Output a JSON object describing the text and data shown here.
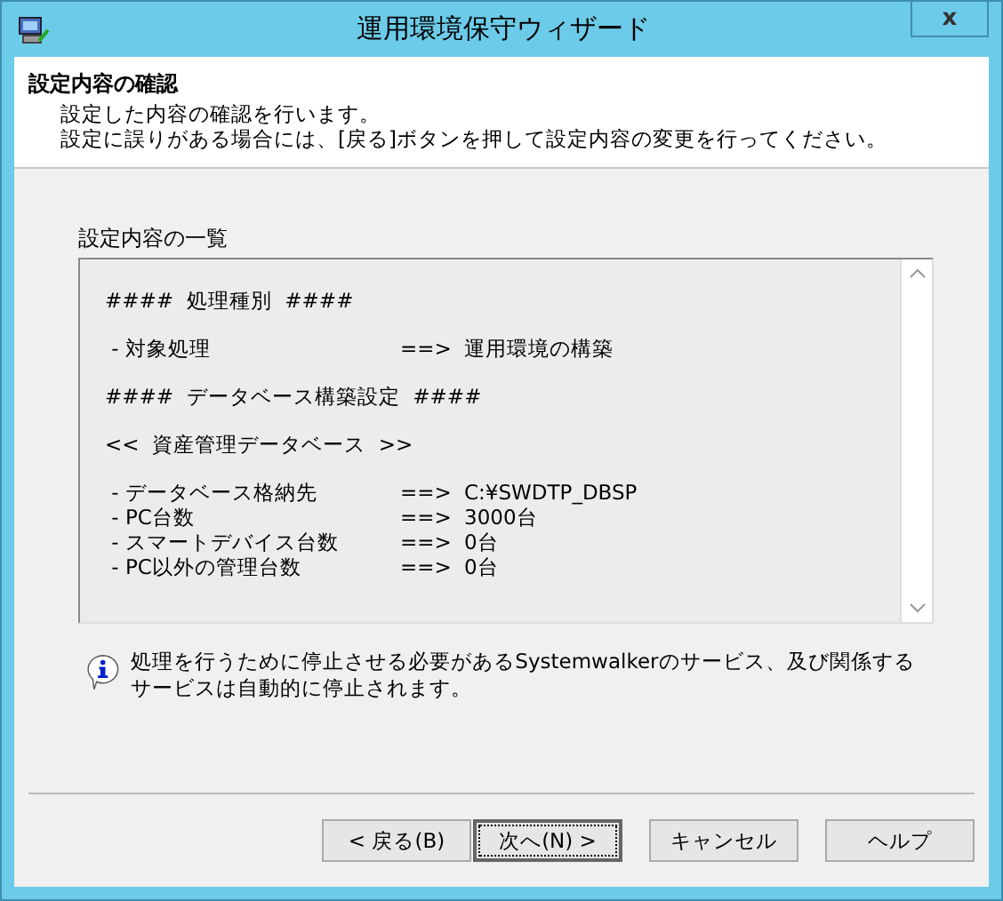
{
  "window": {
    "title": "運用環境保守ウィザード",
    "close": "x"
  },
  "header": {
    "title": "設定内容の確認",
    "lines": [
      "設定した内容の確認を行います。",
      "設定に誤りがある場合には、[戻る]ボタンを押して設定内容の変更を行ってください。"
    ]
  },
  "summary": {
    "label": "設定内容の一覧",
    "lines": [
      {
        "kind": "heading",
        "text": "####  処理種別  ####"
      },
      {
        "kind": "blank"
      },
      {
        "kind": "item",
        "name": " - 対象処理",
        "arrow": "==>",
        "value": "運用環境の構築"
      },
      {
        "kind": "blank"
      },
      {
        "kind": "heading",
        "text": "####  データベース構築設定  ####"
      },
      {
        "kind": "blank"
      },
      {
        "kind": "heading",
        "text": "<<  資産管理データベース  >>"
      },
      {
        "kind": "blank"
      },
      {
        "kind": "item",
        "name": " - データベース格納先",
        "arrow": "==>",
        "value": "C:¥SWDTP_DBSP"
      },
      {
        "kind": "item",
        "name": " - PC台数",
        "arrow": "==>",
        "value": "3000台"
      },
      {
        "kind": "item",
        "name": " - スマートデバイス台数",
        "arrow": "==>",
        "value": "0台"
      },
      {
        "kind": "item",
        "name": " - PC以外の管理台数",
        "arrow": "==>",
        "value": "0台"
      }
    ]
  },
  "info": "処理を行うために停止させる必要があるSystemwalkerのサービス、及び関係するサービスは自動的に停止されます。",
  "buttons": [
    {
      "label": "< 戻る(B)",
      "focused": false
    },
    {
      "label": "次へ(N) >",
      "focused": true
    },
    {
      "label": "キャンセル",
      "focused": false
    },
    {
      "label": "ヘルプ",
      "focused": false
    }
  ]
}
